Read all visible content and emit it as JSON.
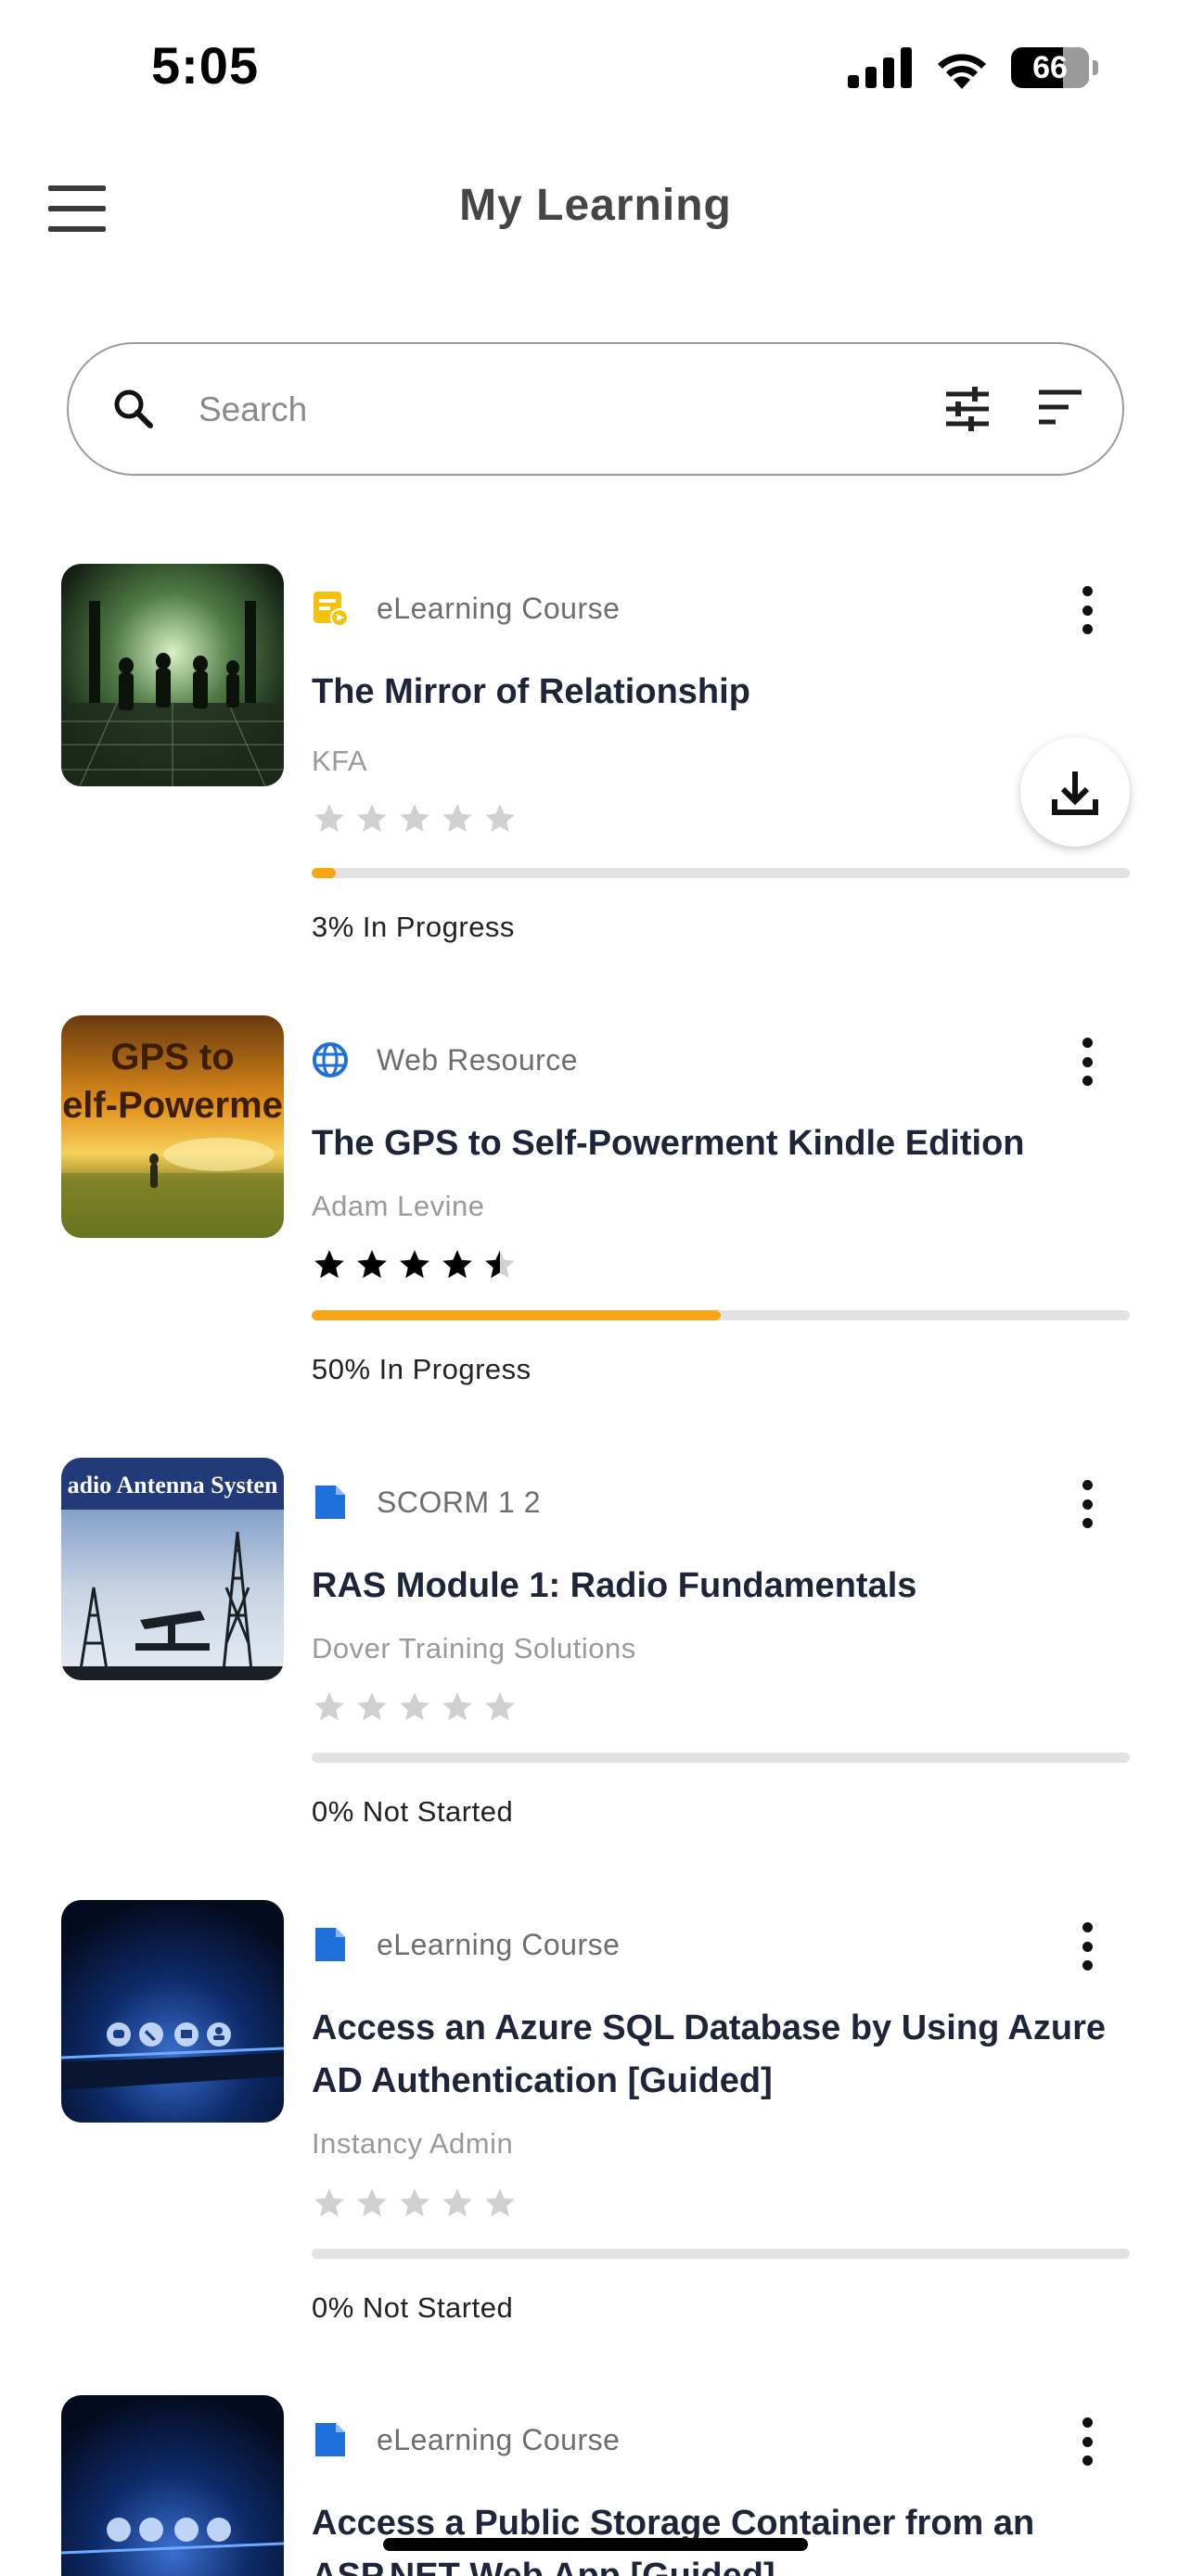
{
  "status_bar": {
    "time": "5:05",
    "battery": "66"
  },
  "header": {
    "title": "My Learning"
  },
  "search": {
    "placeholder": "Search",
    "value": ""
  },
  "colors": {
    "accent": "#f6a514",
    "star_filled": "#000000",
    "star_empty": "#d0d0d0",
    "type_blue": "#1e6fd9",
    "type_yellow": "#f4c20d"
  },
  "courses": [
    {
      "type": "eLearning Course",
      "type_icon": "elearning-video-icon",
      "title": "The Mirror of Relationship",
      "author": "KFA",
      "rating": 0,
      "progress_percent": 3,
      "progress_text": "3% In Progress",
      "thumbnail": "mirror-corridor-image"
    },
    {
      "type": "Web Resource",
      "type_icon": "globe-icon",
      "title": "The GPS to Self-Powerment Kindle Edition",
      "author": "Adam Levine",
      "rating": 4.5,
      "progress_percent": 50,
      "progress_text": "50% In Progress",
      "thumbnail": "gps-book-cover",
      "thumb_text": [
        "GPS to",
        "elf-Powerme"
      ]
    },
    {
      "type": "SCORM 1 2",
      "type_icon": "document-icon",
      "title": "RAS Module 1:  Radio Fundamentals",
      "author": "Dover Training Solutions",
      "rating": 0,
      "progress_percent": 0,
      "progress_text": "0% Not Started",
      "thumbnail": "radio-towers-image",
      "thumb_text": [
        "adio Antenna Systen"
      ]
    },
    {
      "type": "eLearning Course",
      "type_icon": "document-icon",
      "title": "Access an Azure SQL Database by Using Azure AD Authentication [Guided]",
      "author": "Instancy Admin",
      "rating": 0,
      "progress_percent": 0,
      "progress_text": "0% Not Started",
      "thumbnail": "phone-comms-image"
    },
    {
      "type": "eLearning Course",
      "type_icon": "document-icon",
      "title": "Access a Public Storage Container from an ASP.NET Web App [Guided]",
      "thumbnail": "phone-comms-image"
    }
  ]
}
